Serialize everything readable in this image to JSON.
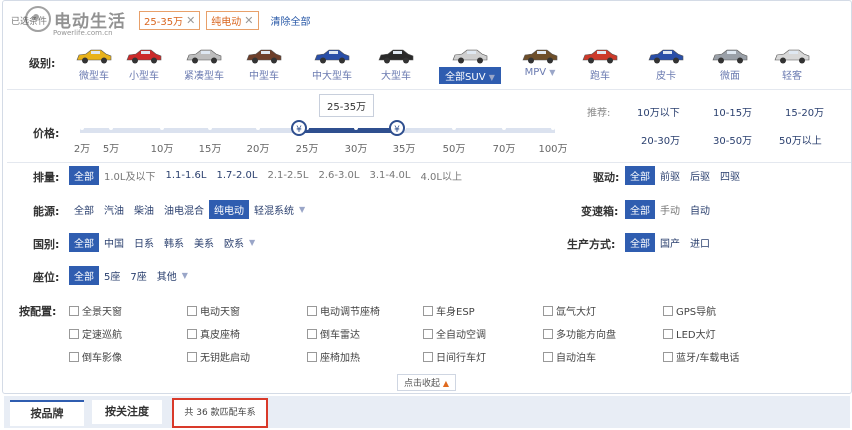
{
  "logo": {
    "text": "电动生活",
    "sub": "Powerlife.com.cn"
  },
  "filters": {
    "prefix": "已选条件",
    "tags": [
      "25-35万",
      "纯电动"
    ],
    "clear": "清除全部"
  },
  "level": {
    "label": "级别:",
    "items": [
      {
        "name": "微型车"
      },
      {
        "name": "小型车"
      },
      {
        "name": "紧凑型车"
      },
      {
        "name": "中型车"
      },
      {
        "name": "中大型车"
      },
      {
        "name": "大型车"
      },
      {
        "name": "全部SUV"
      },
      {
        "name": "MPV"
      },
      {
        "name": "跑车"
      },
      {
        "name": "皮卡"
      },
      {
        "name": "微面"
      },
      {
        "name": "轻客"
      }
    ],
    "selected": "全部SUV",
    "colors": [
      "#e8b21a",
      "#cc2a2a",
      "#bdbdbd",
      "#6e3f2a",
      "#2a4fa8",
      "#2a2a2a",
      "#cfcfcf",
      "#6e4f2a",
      "#cc3a2a",
      "#2a4fa8",
      "#9aa0a8",
      "#d8d8d8"
    ]
  },
  "price": {
    "label": "价格:",
    "bubble": "25-35万",
    "ticks": [
      "2万",
      "5万",
      "10万",
      "15万",
      "20万",
      "25万",
      "30万",
      "35万",
      "50万",
      "70万",
      "100万"
    ],
    "range": [
      "25万",
      "35万"
    ],
    "knob": "¥",
    "recommend_label": "推荐:",
    "recommend": [
      "10万以下",
      "10-15万",
      "15-20万",
      "20-30万",
      "30-50万",
      "50万以上"
    ]
  },
  "displacement": {
    "label": "排量:",
    "options": [
      "全部",
      "1.0L及以下",
      "1.1-1.6L",
      "1.7-2.0L",
      "2.1-2.5L",
      "2.6-3.0L",
      "3.1-4.0L",
      "4.0L以上"
    ],
    "selected": "全部"
  },
  "drive": {
    "label": "驱动:",
    "options": [
      "全部",
      "前驱",
      "后驱",
      "四驱"
    ],
    "selected": "全部"
  },
  "energy": {
    "label": "能源:",
    "options": [
      "全部",
      "汽油",
      "柴油",
      "油电混合",
      "纯电动",
      "轻混系统"
    ],
    "selected": "纯电动"
  },
  "gearbox": {
    "label": "变速箱:",
    "options": [
      "全部",
      "手动",
      "自动"
    ],
    "selected": "全部"
  },
  "country": {
    "label": "国别:",
    "options": [
      "全部",
      "中国",
      "日系",
      "韩系",
      "美系",
      "欧系"
    ],
    "selected": "全部"
  },
  "production": {
    "label": "生产方式:",
    "options": [
      "全部",
      "国产",
      "进口"
    ],
    "selected": "全部"
  },
  "seats": {
    "label": "座位:",
    "options": [
      "全部",
      "5座",
      "7座",
      "其他"
    ],
    "selected": "全部"
  },
  "config": {
    "label": "按配置:",
    "items": [
      "全景天窗",
      "电动天窗",
      "电动调节座椅",
      "车身ESP",
      "氙气大灯",
      "GPS导航",
      "定速巡航",
      "真皮座椅",
      "倒车雷达",
      "全自动空调",
      "多功能方向盘",
      "LED大灯",
      "倒车影像",
      "无钥匙启动",
      "座椅加热",
      "日间行车灯",
      "自动泊车",
      "蓝牙/车载电话"
    ]
  },
  "collapse": "点击收起",
  "tabs": {
    "brand": "按品牌",
    "attention": "按关注度",
    "count": "共 36 款匹配车系"
  }
}
